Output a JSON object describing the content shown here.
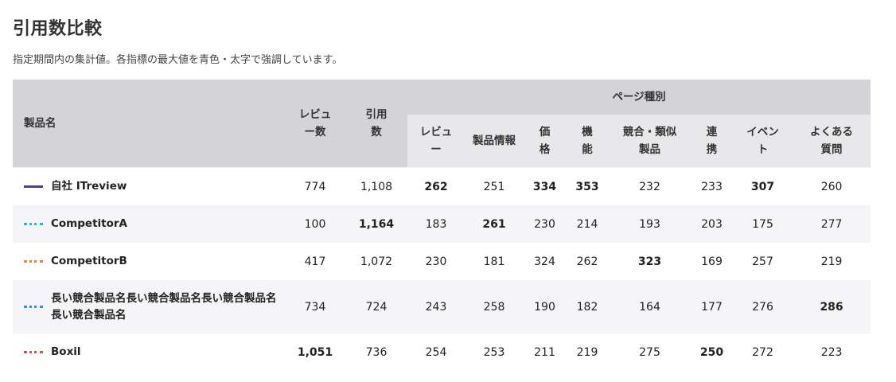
{
  "page": {
    "title": "引用数比較",
    "description": "指定期間内の集計値。各指標の最大値を青色・太字で強調しています。"
  },
  "table": {
    "headers": {
      "product": "製品名",
      "reviews": "レビュー数",
      "citations": "引用数",
      "page_type_group": "ページ種別",
      "page_types": [
        "レビュー",
        "製品情報",
        "価格",
        "機能",
        "競合・類似製品",
        "連携",
        "イベント",
        "よくある質問"
      ]
    },
    "rows": [
      {
        "name": "自社 ITreview",
        "line_style": "solid",
        "line_color": "#4b3f8f",
        "values": [
          "774",
          "1,108",
          "262",
          "251",
          "334",
          "353",
          "232",
          "233",
          "307",
          "260"
        ],
        "max": [
          false,
          false,
          true,
          false,
          true,
          true,
          false,
          false,
          true,
          false
        ]
      },
      {
        "name": "CompetitorA",
        "line_style": "dotted",
        "line_color": "#2bb5c9",
        "values": [
          "100",
          "1,164",
          "183",
          "261",
          "230",
          "214",
          "193",
          "203",
          "175",
          "277"
        ],
        "max": [
          false,
          true,
          false,
          true,
          false,
          false,
          false,
          false,
          false,
          false
        ]
      },
      {
        "name": "CompetitorB",
        "line_style": "dotted",
        "line_color": "#e8823a",
        "values": [
          "417",
          "1,072",
          "230",
          "181",
          "324",
          "262",
          "323",
          "169",
          "257",
          "219"
        ],
        "max": [
          false,
          false,
          false,
          false,
          false,
          false,
          true,
          false,
          false,
          false
        ]
      },
      {
        "name": "長い競合製品名長い競合製品名長い競合製品名長い競合製品名",
        "line_style": "dotted",
        "line_color": "#3a8fd9",
        "values": [
          "734",
          "724",
          "243",
          "258",
          "190",
          "182",
          "164",
          "177",
          "276",
          "286"
        ],
        "max": [
          false,
          false,
          false,
          false,
          false,
          false,
          false,
          false,
          false,
          true
        ]
      },
      {
        "name": "Boxil",
        "line_style": "dotted",
        "line_color": "#d9543f",
        "values": [
          "1,051",
          "736",
          "254",
          "253",
          "211",
          "219",
          "275",
          "250",
          "272",
          "223"
        ],
        "max": [
          true,
          false,
          false,
          false,
          false,
          false,
          false,
          true,
          false,
          false
        ]
      }
    ]
  },
  "colors": {
    "max_value": "#2c4fb3",
    "header_dark": "#d4d4d8",
    "header_light": "#e8e8eb",
    "row_alt": "#f5f5f7"
  }
}
